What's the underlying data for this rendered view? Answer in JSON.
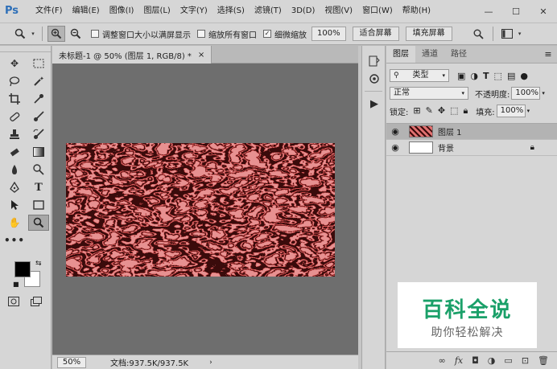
{
  "app": {
    "logo": "Ps"
  },
  "menu": [
    "文件(F)",
    "编辑(E)",
    "图像(I)",
    "图层(L)",
    "文字(Y)",
    "选择(S)",
    "滤镜(T)",
    "3D(D)",
    "视图(V)",
    "窗口(W)",
    "帮助(H)"
  ],
  "window_controls": {
    "minimize": "—",
    "maximize": "☐",
    "close": "✕"
  },
  "options": {
    "resize_windows": "调整窗口大小以满屏显示",
    "zoom_all": "缩放所有窗口",
    "scrubby_zoom": "细微缩放",
    "zoom_value": "100%",
    "fit_screen": "适合屏幕",
    "fill_screen": "填充屏幕"
  },
  "document": {
    "tab_title": "未标题-1 @ 50% (图层 1, RGB/8) *",
    "close": "×",
    "texture_colors": {
      "dark": "#3a0b0b",
      "mid": "#c94848",
      "light": "#f4a0a0"
    }
  },
  "status": {
    "zoom": "50%",
    "doc_info": "文档:937.5K/937.5K",
    "arrow": "›"
  },
  "layers_panel": {
    "tabs": [
      "图层",
      "通道",
      "路径"
    ],
    "filter_kind": "类型",
    "blend_mode": "正常",
    "opacity_label": "不透明度:",
    "opacity_value": "100%",
    "lock_label": "锁定:",
    "fill_label": "填充:",
    "fill_value": "100%",
    "layers": [
      {
        "name": "图层 1",
        "thumb": "texture",
        "selected": true
      },
      {
        "name": "背景",
        "thumb": "white",
        "locked": true
      }
    ]
  },
  "watermark": {
    "title": "百科全说",
    "subtitle": "助你轻松解决",
    "title_color": "#1aa069"
  }
}
